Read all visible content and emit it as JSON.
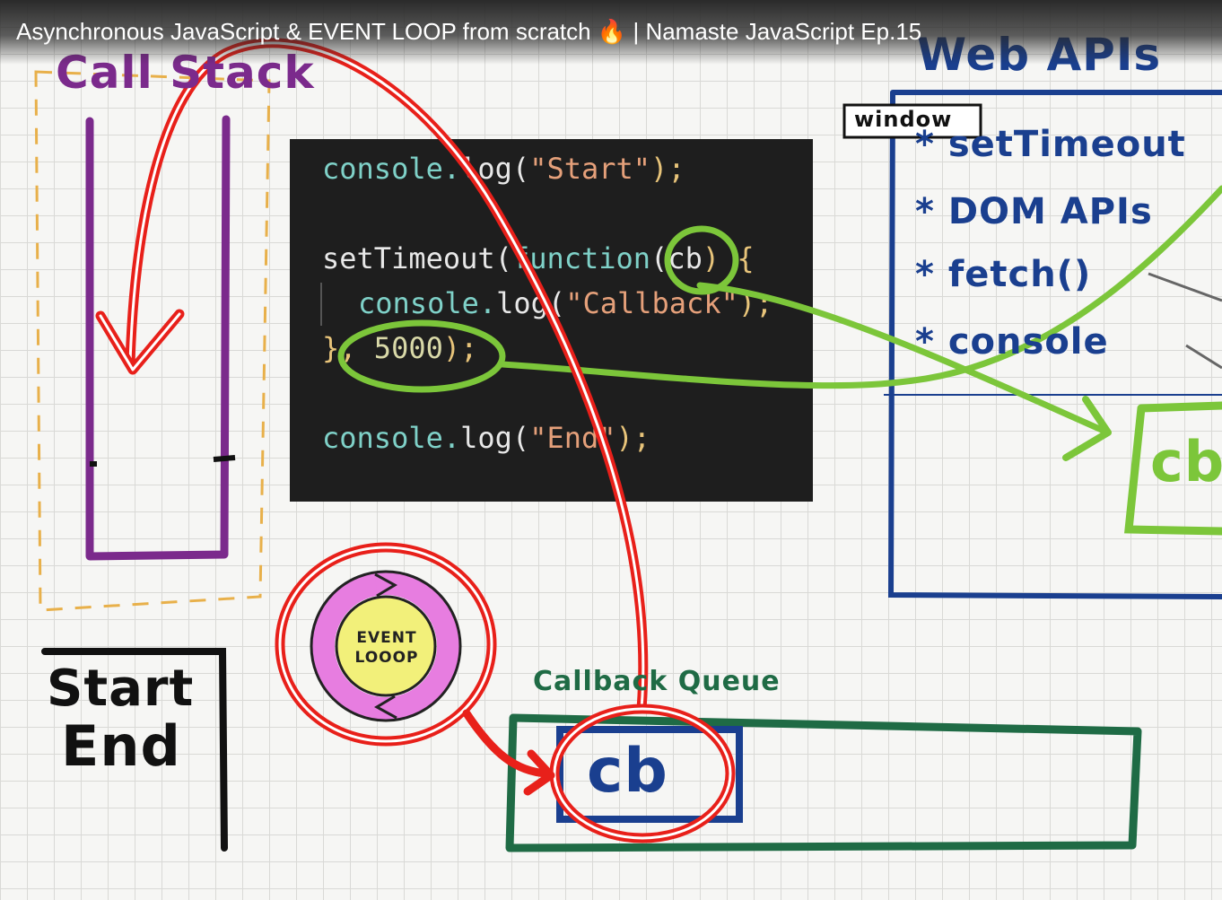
{
  "video": {
    "title_left": "Asynchronous JavaScript & EVENT LOOP from scratch",
    "title_emoji": "🔥",
    "title_right": "| Namaste JavaScript Ep.15"
  },
  "call_stack": {
    "label": "Call Stack"
  },
  "web_apis": {
    "title": "Web APIs",
    "window_label": "window",
    "items": [
      "* setTimeout",
      "* DOM APIs",
      "* fetch()",
      "* console"
    ],
    "cb_label": "cb"
  },
  "code": {
    "line1_obj": "console.",
    "line1_fn": "log(",
    "line1_str": "\"Start\"",
    "line1_end": ");",
    "line2_fn": "setTimeout(",
    "line2_kw": "function",
    "line2_param": "cb",
    "line2_end": ") {",
    "line3_obj": "console.",
    "line3_fn": "log(",
    "line3_str": "\"Callback\"",
    "line3_end": ");",
    "line4_close": "}, ",
    "line4_num": "5000",
    "line4_end": ");",
    "line5_obj": "console.",
    "line5_fn": "log(",
    "line5_str": "\"End\"",
    "line5_end": ");"
  },
  "event_loop": {
    "line1": "EVENT",
    "line2": "LOOOP"
  },
  "console_output": {
    "line1": "Start",
    "line2": "End"
  },
  "callback_queue": {
    "label": "Callback Queue",
    "item": "cb"
  },
  "colors": {
    "call_stack": "#7b2a8c",
    "web_apis": "#1a3f8f",
    "callback_queue": "#1f6b45",
    "green_annotation": "#7cc63a",
    "red_annotation": "#e8201a",
    "event_loop_ring": "#e77de0",
    "event_loop_center": "#f2f07a",
    "dashed_border": "#e8b04a"
  }
}
